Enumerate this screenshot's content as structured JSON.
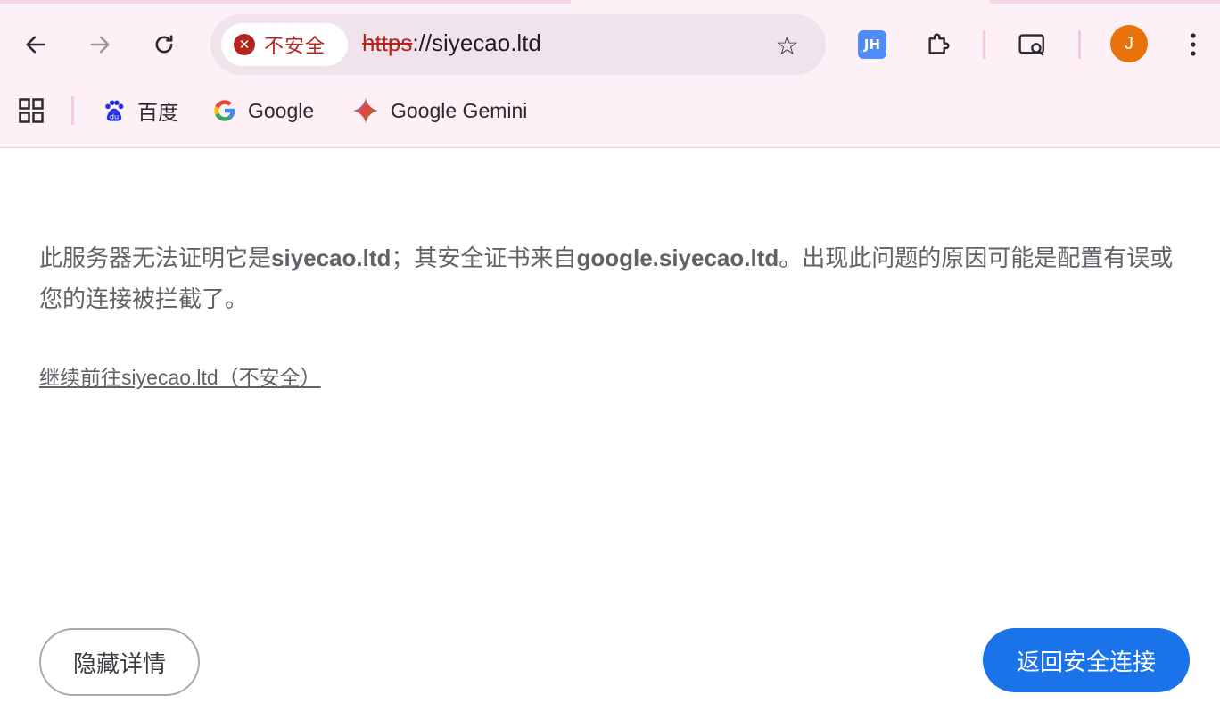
{
  "toolbar": {
    "security_chip_label": "不安全",
    "url_scheme": "https",
    "url_rest": "://siyecao.ltd",
    "extension_badge": "JH",
    "profile_initial": "J"
  },
  "bookmarks": [
    {
      "label": "百度",
      "icon": "baidu-icon"
    },
    {
      "label": "Google",
      "icon": "google-g-icon"
    },
    {
      "label": "Google Gemini",
      "icon": "gemini-sparkle-icon"
    }
  ],
  "interstitial": {
    "msg_part1": "此服务器无法证明它是",
    "msg_domain1": "siyecao.ltd",
    "msg_part2": "；其安全证书来自",
    "msg_domain2": "google.siyecao.ltd",
    "msg_part3": "。出现此问题的原因可能是配置有误或您的连接被拦截了。",
    "proceed_link": "继续前往siyecao.ltd（不安全）",
    "hide_details_button": "隐藏详情",
    "back_to_safety_button": "返回安全连接"
  },
  "colors": {
    "toolbar_bg": "#fdf0f6",
    "danger": "#b3261e",
    "primary_button": "#1a73e8",
    "avatar": "#e8710a"
  }
}
